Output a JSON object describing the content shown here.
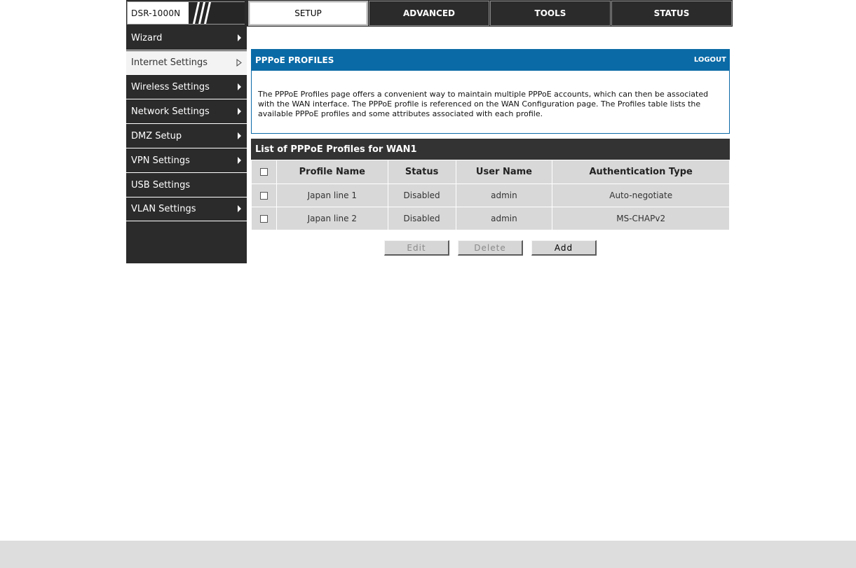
{
  "brand": {
    "model": "DSR-1000N"
  },
  "tabs": [
    {
      "label": "SETUP",
      "active": true
    },
    {
      "label": "ADVANCED",
      "active": false
    },
    {
      "label": "TOOLS",
      "active": false
    },
    {
      "label": "STATUS",
      "active": false
    }
  ],
  "sidebar": {
    "items": [
      {
        "label": "Wizard",
        "active": false
      },
      {
        "label": "Internet Settings",
        "active": true
      },
      {
        "label": "Wireless Settings",
        "active": false
      },
      {
        "label": "Network Settings",
        "active": false
      },
      {
        "label": "DMZ Setup",
        "active": false
      },
      {
        "label": "VPN Settings",
        "active": false
      },
      {
        "label": "USB Settings",
        "active": false
      },
      {
        "label": "VLAN Settings",
        "active": false
      }
    ]
  },
  "panel": {
    "title": "PPPoE PROFILES",
    "logout": "LOGOUT",
    "description": "The PPPoE Profiles page offers a convenient way to maintain multiple PPPoE accounts, which can then be associated with the WAN interface. The PPPoE profile is referenced on the WAN Configuration page. The Profiles table lists the available PPPoE profiles and some attributes associated with each profile."
  },
  "list": {
    "title": "List of PPPoE Profiles for WAN1",
    "columns": [
      "Profile Name",
      "Status",
      "User Name",
      "Authentication Type"
    ],
    "rows": [
      {
        "profile_name": "Japan line 1",
        "status": "Disabled",
        "user_name": "admin",
        "auth_type": "Auto-negotiate"
      },
      {
        "profile_name": "Japan line 2",
        "status": "Disabled",
        "user_name": "admin",
        "auth_type": "MS-CHAPv2"
      }
    ]
  },
  "buttons": {
    "edit": "Edit",
    "delete": "Delete",
    "add": "Add"
  },
  "colors": {
    "accent_blue": "#0a6aa6",
    "dark_bar": "#2b2b2b",
    "table_cell": "#d8d8d8"
  }
}
